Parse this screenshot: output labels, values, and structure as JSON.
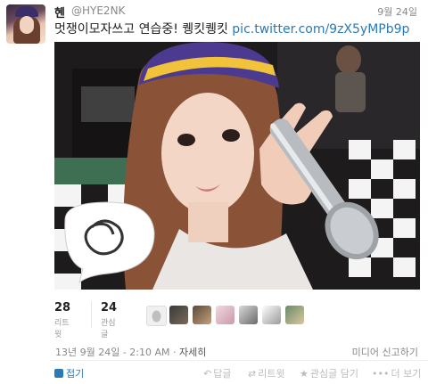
{
  "tweet": {
    "display_name": "혠",
    "handle": "@HYE2NK",
    "date": "9월 24일",
    "text": "멋쟁이모자쓰고 연습중! 퀭킷퀭킷",
    "link": "pic.twitter.com/9zX5yMPb9p"
  },
  "stats": {
    "retweets": {
      "count": "28",
      "label": "리트윗"
    },
    "favorites": {
      "count": "24",
      "label": "관심글"
    }
  },
  "meta": {
    "timestamp": "13년 9월 24일 - 2:10 AM",
    "separator": "·",
    "details": "자세히",
    "report": "미디어 신고하기"
  },
  "actions": {
    "collapse": "접기",
    "reply": "답글",
    "retweet": "리트윗",
    "favorite": "관심글 담기",
    "more": "더 보기"
  },
  "colors": {
    "link": "#2a7ab8",
    "muted": "#888888",
    "action_disabled": "#bbbbbb"
  },
  "icons": {
    "reply": "reply-arrow-icon",
    "retweet": "retweet-icon",
    "favorite": "star-icon",
    "more": "more-dots-icon",
    "collapse": "collapse-icon"
  }
}
